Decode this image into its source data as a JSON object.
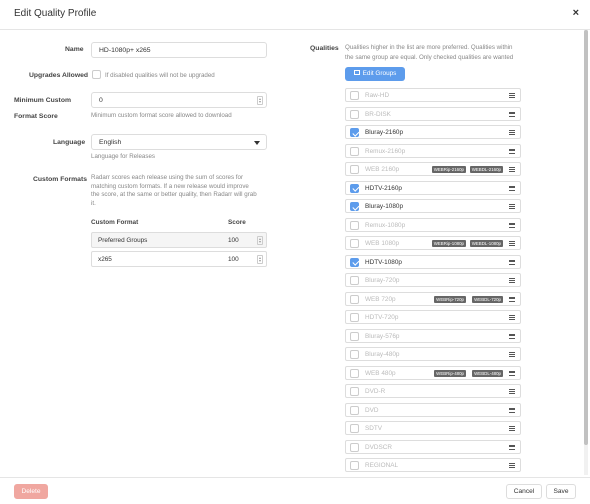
{
  "modal": {
    "title": "Edit Quality Profile",
    "close_label": "×"
  },
  "form": {
    "name_label": "Name",
    "name_value": "HD-1080p+ x265",
    "upgrades_label": "Upgrades Allowed",
    "upgrades_help": "If disabled qualities will not be upgraded",
    "upgrades_checked": false,
    "min_score_label_1": "Minimum Custom",
    "min_score_label_2": "Format Score",
    "min_score_value": "0",
    "min_score_help": "Minimum custom format score allowed to download",
    "language_label": "Language",
    "language_value": "English",
    "language_help": "Language for Releases",
    "cf_label": "Custom Formats",
    "cf_help_lines": [
      "Radarr scores each release using the sum of scores for",
      "matching custom formats. If a new release would improve",
      "the score, at the same or better quality, then Radarr will grab",
      "it."
    ],
    "cf_col_format": "Custom Format",
    "cf_col_score": "Score",
    "custom_formats": [
      {
        "name": "Preferred Groups",
        "score": "100"
      },
      {
        "name": "x265",
        "score": "100"
      }
    ]
  },
  "qualities": {
    "label": "Qualities",
    "help_lines": [
      "Qualities higher in the list are more preferred. Qualities within",
      "the same group are equal. Only checked qualities are wanted"
    ],
    "edit_groups_label": "Edit Groups",
    "items": [
      {
        "name": "Raw-HD",
        "checked": false,
        "tags": []
      },
      {
        "name": "BR-DISK",
        "checked": false,
        "tags": []
      },
      {
        "name": "Bluray-2160p",
        "checked": true,
        "tags": []
      },
      {
        "name": "Remux-2160p",
        "checked": false,
        "tags": []
      },
      {
        "name": "WEB 2160p",
        "checked": false,
        "tags": [
          "WEBRip-2160p",
          "WEBDL-2160p"
        ]
      },
      {
        "name": "HDTV-2160p",
        "checked": true,
        "tags": []
      },
      {
        "name": "Bluray-1080p",
        "checked": true,
        "tags": []
      },
      {
        "name": "Remux-1080p",
        "checked": false,
        "tags": []
      },
      {
        "name": "WEB 1080p",
        "checked": false,
        "tags": [
          "WEBRip-1080p",
          "WEBDL-1080p"
        ]
      },
      {
        "name": "HDTV-1080p",
        "checked": true,
        "tags": []
      },
      {
        "name": "Bluray-720p",
        "checked": false,
        "tags": []
      },
      {
        "name": "WEB 720p",
        "checked": false,
        "tags": [
          "WEBRip-720p",
          "WEBDL-720p"
        ]
      },
      {
        "name": "HDTV-720p",
        "checked": false,
        "tags": []
      },
      {
        "name": "Bluray-576p",
        "checked": false,
        "tags": []
      },
      {
        "name": "Bluray-480p",
        "checked": false,
        "tags": []
      },
      {
        "name": "WEB 480p",
        "checked": false,
        "tags": [
          "WEBRip-480p",
          "WEBDL-480p"
        ]
      },
      {
        "name": "DVD-R",
        "checked": false,
        "tags": []
      },
      {
        "name": "DVD",
        "checked": false,
        "tags": []
      },
      {
        "name": "SDTV",
        "checked": false,
        "tags": []
      },
      {
        "name": "DVDSCR",
        "checked": false,
        "tags": []
      },
      {
        "name": "REGIONAL",
        "checked": false,
        "tags": []
      }
    ]
  },
  "footer": {
    "delete_label": "Delete",
    "cancel_label": "Cancel",
    "save_label": "Save"
  },
  "colors": {
    "accent": "#5d9cec",
    "danger": "#f0a7a0"
  }
}
